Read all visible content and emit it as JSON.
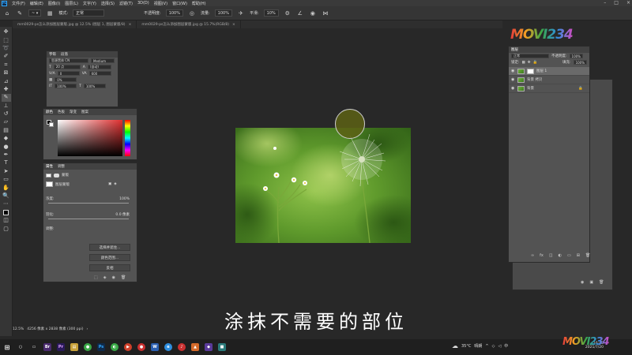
{
  "menubar": {
    "app_icon": "Ps",
    "items": [
      "文件(F)",
      "编辑(E)",
      "图像(I)",
      "图层(L)",
      "文字(Y)",
      "选择(S)",
      "滤镜(T)",
      "3D(D)",
      "视图(V)",
      "窗口(W)",
      "帮助(H)"
    ]
  },
  "options_bar": {
    "mode_label": "模式:",
    "mode_value": "正常",
    "opacity_label": "不透明度:",
    "opacity_value": "100%",
    "flow_label": "流量:",
    "flow_value": "100%",
    "smooth_label": "平滑:",
    "smooth_value": "10%",
    "brush_size": "~"
  },
  "document_tabs": [
    {
      "label": "mm0029-ps怎么添加图层蒙版.jpg @ 12.5% (图层 1, 图层蒙版/8)",
      "active": false
    },
    {
      "label": "mm0029-ps怎么添加图层蒙版.jpg @ 15.7%(RGB/8)",
      "active": false
    }
  ],
  "character_panel": {
    "tabs": [
      "字符",
      "段落"
    ],
    "font_family": "思源黑体 CN",
    "font_style": "Medium",
    "font_size": "20 点",
    "leading": "(自动)",
    "tracking_left": "0",
    "tracking_right": "600",
    "scale_pct": "0%",
    "vscale": "100%",
    "hscale": "100%"
  },
  "color_panel": {
    "tabs": [
      "颜色",
      "色板",
      "渐变",
      "图案"
    ],
    "hue_color": "#e03030"
  },
  "properties_panel": {
    "tabs": [
      "属性",
      "调整"
    ],
    "mask_kind": "蒙版",
    "layer_mask_label": "图层蒙版",
    "density_label": "浓度:",
    "density_value": "100%",
    "feather_label": "羽化:",
    "feather_value": "0.0 像素",
    "refine_label": "调整:",
    "select_and_mask_button": "选择并遮住...",
    "color_range_button": "颜色范围...",
    "invert_button": "反相"
  },
  "layers_panel": {
    "tab": "图层",
    "blend_mode": "正常",
    "opacity_label": "不透明度:",
    "opacity_value": "100%",
    "lock_label": "锁定:",
    "fill_label": "填充:",
    "fill_value": "100%",
    "layers": [
      {
        "name": "图层 1",
        "has_mask": true,
        "selected": true
      },
      {
        "name": "背景 拷贝",
        "has_mask": false,
        "selected": false
      },
      {
        "name": "背景",
        "has_mask": false,
        "selected": false,
        "locked": true
      }
    ]
  },
  "status_bar": {
    "zoom": "12.5%",
    "doc_info": "4256 像素 x 2838 像素 (300 ppi)"
  },
  "subtitle": "涂抹不需要的部位",
  "watermark": {
    "text": "MOVI234",
    "colors": [
      "#e23b3b",
      "#f2a024",
      "#3aa847",
      "#2f8fe0",
      "#d14bc0"
    ]
  },
  "taskbar": {
    "weather": "35°C",
    "weather_desc": "晴朗",
    "time": "16:43",
    "date": "2021/7/20",
    "ime": "中"
  }
}
